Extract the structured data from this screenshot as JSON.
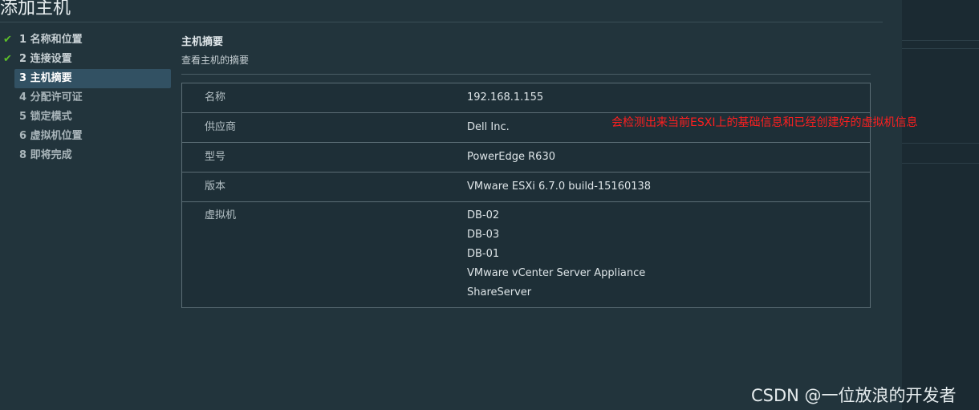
{
  "dialog": {
    "title": "添加主机"
  },
  "steps": [
    {
      "label": "1 名称和位置",
      "state": "done"
    },
    {
      "label": "2 连接设置",
      "state": "done"
    },
    {
      "label": "3 主机摘要",
      "state": "active"
    },
    {
      "label": "4 分配许可证",
      "state": "pending"
    },
    {
      "label": "5 锁定模式",
      "state": "pending"
    },
    {
      "label": "6 虚拟机位置",
      "state": "pending"
    },
    {
      "label": "8 即将完成",
      "state": "pending"
    }
  ],
  "summary": {
    "title": "主机摘要",
    "subtitle": "查看主机的摘要",
    "rows": [
      {
        "label": "名称",
        "value": "192.168.1.155"
      },
      {
        "label": "供应商",
        "value": "Dell Inc."
      },
      {
        "label": "型号",
        "value": "PowerEdge R630"
      },
      {
        "label": "版本",
        "value": "VMware ESXi 6.7.0 build-15160138"
      }
    ],
    "vm_label": "虚拟机",
    "vms": [
      "DB-02",
      "DB-03",
      "DB-01",
      "VMware vCenter Server Appliance",
      "ShareServer"
    ]
  },
  "annotation": "会检测出来当前ESXI上的基础信息和已经创建好的虚拟机信息",
  "watermark": "CSDN @一位放浪的开发者",
  "colors": {
    "check": "#5cbf2a",
    "annotation": "#ff1f1f",
    "active_step": "#325163"
  }
}
